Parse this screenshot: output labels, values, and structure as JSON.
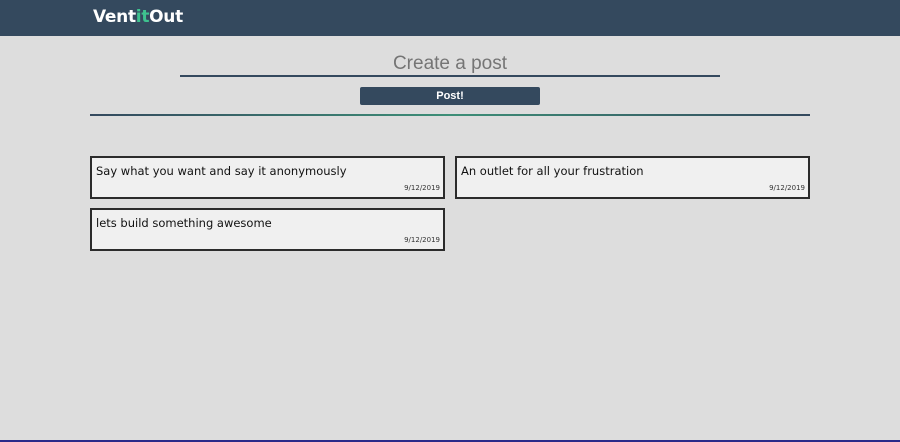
{
  "navbar": {
    "brand_prefix": "Vent",
    "brand_accent": "it",
    "brand_suffix": "Out",
    "background_color": "#34495e",
    "accent_color": "#3ec28f"
  },
  "composer": {
    "placeholder": "Create a post",
    "post_label": "Post!"
  },
  "posts": [
    {
      "text": "Say what you want and say it anonymously",
      "date": "9/12/2019"
    },
    {
      "text": "An outlet for all your frustration",
      "date": "9/12/2019"
    },
    {
      "text": "lets build something awesome",
      "date": "9/12/2019"
    }
  ]
}
